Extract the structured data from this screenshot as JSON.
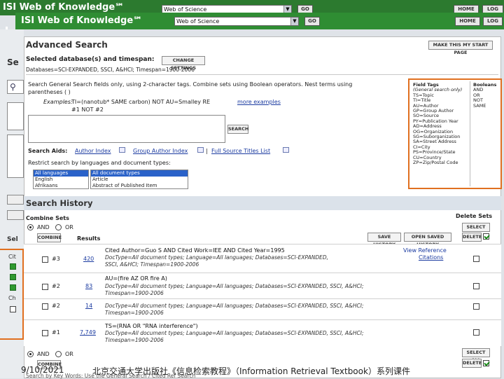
{
  "header_back": {
    "title": "ISI Web of Knowledge℠",
    "db": "Web of Science",
    "go": "GO",
    "home": "HOME",
    "log": "LOG"
  },
  "header": {
    "title": "ISI Web of Knowledge℠",
    "db": "Web of Science",
    "go": "GO",
    "home": "HOME",
    "log": "LOG"
  },
  "left_fragments": [
    "Se",
    "Sel",
    "Cit",
    "Ch"
  ],
  "adv": {
    "title": "Advanced Search",
    "start_page": "MAKE THIS MY START PAGE",
    "db_label": "Selected database(s) and timespan:",
    "change": "CHANGE SETTINGS",
    "databases": "Databases=SCI-EXPANDED, SSCI, A&HCI; Timespan=1900-2006",
    "instr1": "Search General Search fields only, using 2-character tags. Combine sets using Boolean operators. Nest terms using",
    "instr2": "parentheses ( )",
    "examples_label": "Examples:",
    "example1": "TI=(nanotub* SAME carbon) NOT AU=Smalley RE",
    "example2": "#1 NOT #2",
    "more": "more examples",
    "search": "SEARCH",
    "aids": "Search Aids:",
    "author_index": "Author Index",
    "group_author": "Group Author Index",
    "full_source": "Full Source Titles List",
    "restrict": "Restrict search by languages and document types:",
    "languages": [
      "All languages",
      "English",
      "Afrikaans"
    ],
    "doctypes": [
      "All document types",
      "Article",
      "Abstract of Published Item"
    ]
  },
  "field_tags": {
    "header": "Field Tags",
    "note": "(General search only)",
    "items": [
      "TS=Topic",
      "TI=Title",
      "AU=Author",
      "GP=Group Author",
      "SO=Source",
      "PY=Publication Year",
      "AD=Address",
      "OG=Organization",
      "SG=Suborganization",
      "SA=Street Address",
      "CI=City",
      "PS=Province/State",
      "CU=Country",
      "ZP=Zip/Postal Code"
    ]
  },
  "booleans": {
    "header": "Booleans",
    "items": [
      "AND",
      "OR",
      "NOT",
      "SAME"
    ]
  },
  "history": {
    "title": "Search History",
    "combine": "Combine Sets",
    "and": "AND",
    "or": "OR",
    "combine_btn": "COMBINE",
    "results": "Results",
    "save": "SAVE HISTORY",
    "open": "OPEN SAVED HISTORY",
    "delete_sets": "Delete Sets",
    "select_all": "SELECT ALL",
    "delete": "DELETE",
    "view_ref": "View Reference",
    "ref_sub": "Citations",
    "rows": [
      {
        "num": "#3",
        "count": "420",
        "line1": "Cited Author=Guo S AND Cited Work=IEE AND Cited Year=1995",
        "line2": "DocType=All document types; Language=All languages; Databases=SCI-EXPANDED,",
        "line3": "SSCI, A&HCI; Timespan=1900-2006"
      },
      {
        "num": "#2",
        "count": "83",
        "line1": "AU=(fire AZ OR fire A)",
        "line2": "DocType=All document types; Language=All languages; Databases=SCI-EXPANDED, SSCI, A&HCI;",
        "line3": "Timespan=1900-2006"
      },
      {
        "num": "#2",
        "count": "14",
        "line1": "",
        "line2": "DocType=All document types; Language=All languages; Databases=SCI-EXPANDED, SSCI, A&HCI;",
        "line3": "Timespan=1900-2006"
      },
      {
        "num": "#1",
        "count": "7,749",
        "line1": "TS=(RNA OR \"RNA interference\")",
        "line2": "DocType=All document types; Language=All languages; Databases=SCI-EXPANDED, SSCI, A&HCI;",
        "line3": "Timespan=1900-2006"
      }
    ],
    "bottom_text": "Search by Key Words: Use the General Search / Cited Ref Search"
  },
  "footer": {
    "date": "9/10/2021",
    "caption": "北京交通大学出版社《信息检索教程》（Information Retrieval Textbook）系列课件"
  }
}
